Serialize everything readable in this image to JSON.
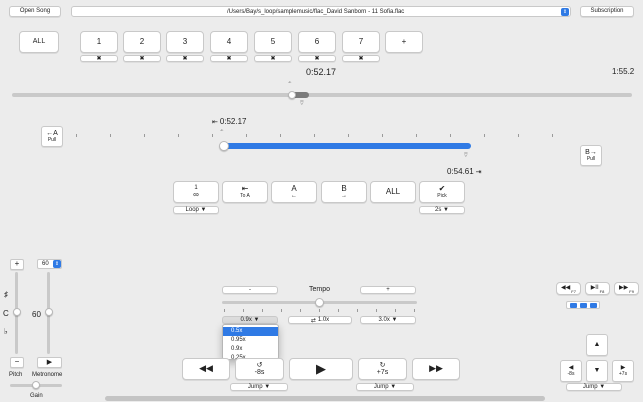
{
  "top": {
    "open_song": "Open Song",
    "file_path": "/Users/Bay/s_loop/samplemusic/flac_David Sanborn - 11 Sofia.flac",
    "subscription": "Subscription"
  },
  "markers": {
    "all": "ALL",
    "items": [
      "1",
      "2",
      "3",
      "4",
      "5",
      "6",
      "7"
    ],
    "add": "+",
    "delete_glyph": "✖"
  },
  "time": {
    "current": "0:52.17",
    "total": "1:55.2",
    "loop_start": "0:52.17",
    "loop_end": "0:54.61",
    "position_fraction": 0.45,
    "loop_start_fraction": 0.45,
    "loop_end_fraction": 0.47
  },
  "ab": {
    "a_title": "←A",
    "a_sub": "Pull",
    "b_title": "B→",
    "b_sub": "Pull"
  },
  "loop_controls": {
    "loop_symbol": "1\n∞",
    "loop_dropdown": "Loop ▼",
    "to_a_icon": "⇤",
    "to_a_label": "To A",
    "a_label": "A",
    "a_arrow": "←",
    "b_label": "B",
    "b_arrow": "→",
    "all_label": "ALL",
    "pick_icon": "✔",
    "pick_label": "Pick",
    "pick_dropdown": "2s ▼"
  },
  "pitch": {
    "plus": "+",
    "minus": "−",
    "value": "60",
    "key": "C",
    "sharp": "♯",
    "flat": "♭",
    "label": "Pitch"
  },
  "metronome": {
    "bpm": "60",
    "play": "▶",
    "label": "Metronome"
  },
  "gain": {
    "label": "Gain"
  },
  "tempo": {
    "minus": "-",
    "label": "Tempo",
    "plus": "+",
    "rate_button": "0.9x ▼",
    "reset_label": "1.0x",
    "max_button": "3.0x ▼",
    "options": [
      "0.5x",
      "0.95x",
      "0.9x",
      "0.25x"
    ],
    "selected_option": "0.5x"
  },
  "transport": {
    "rewind": "◀◀",
    "back_label": "-8s",
    "play": "▶",
    "fwd_label": "+7s",
    "fast_forward": "▶▶",
    "jump_left": "Jump ▼",
    "jump_right": "Jump ▼"
  },
  "fkeys": {
    "rewind": "◀◀",
    "rewind_key": "F7",
    "play_pause": "▶II",
    "play_pause_key": "F8",
    "ff": "▶▶",
    "ff_key": "F9"
  },
  "right_nav": {
    "up": "▲",
    "down": "▼",
    "left_label": "-8s",
    "left_key": "◀",
    "right_label": "+7s",
    "right_key": "▶",
    "jump": "Jump ▼"
  }
}
